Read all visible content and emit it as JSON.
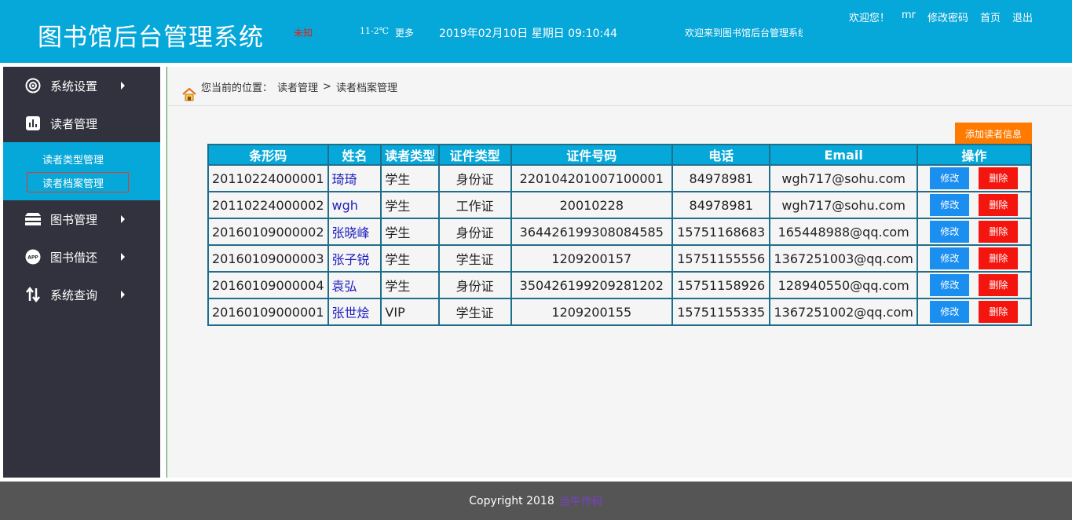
{
  "header": {
    "title": "图书馆后台管理系统",
    "weather_status": "未知",
    "weather_temp": "11-2℃",
    "weather_more": "更多",
    "datetime": "2019年02月10日 星期日 09:10:44",
    "marquee": "欢迎来到图书馆后台管理系统",
    "welcome": "欢迎您！",
    "username": "mr",
    "change_password": "修改密码",
    "home": "首页",
    "logout": "退出"
  },
  "sidebar": {
    "items": [
      {
        "label": "系统设置",
        "icon": "gear-icon"
      },
      {
        "label": "读者管理",
        "icon": "chart-icon"
      },
      {
        "label": "图书管理",
        "icon": "books-icon"
      },
      {
        "label": "图书借还",
        "icon": "app-icon"
      },
      {
        "label": "系统查询",
        "icon": "swap-icon"
      }
    ],
    "sub_items": [
      {
        "label": "读者类型管理"
      },
      {
        "label": "读者档案管理"
      }
    ]
  },
  "breadcrumb": {
    "prefix": "您当前的位置：",
    "level1": "读者管理",
    "separator": ">",
    "level2": "读者档案管理"
  },
  "add_button": "添加读者信息",
  "table": {
    "headers": [
      "条形码",
      "姓名",
      "读者类型",
      "证件类型",
      "证件号码",
      "电话",
      "Email",
      "操作"
    ],
    "edit_label": "修改",
    "delete_label": "删除",
    "rows": [
      {
        "barcode": "20110224000001",
        "name": "琦琦",
        "type": "学生",
        "id_type": "身份证",
        "id_no": "220104201007100001",
        "phone": "84978981",
        "email": "wgh717@sohu.com"
      },
      {
        "barcode": "20110224000002",
        "name": "wgh",
        "type": "学生",
        "id_type": "工作证",
        "id_no": "20010228",
        "phone": "84978981",
        "email": "wgh717@sohu.com"
      },
      {
        "barcode": "20160109000002",
        "name": "张晓峰",
        "type": "学生",
        "id_type": "身份证",
        "id_no": "364426199308084585",
        "phone": "15751168683",
        "email": "165448988@qq.com"
      },
      {
        "barcode": "20160109000003",
        "name": "张子锐",
        "type": "学生",
        "id_type": "学生证",
        "id_no": "1209200157",
        "phone": "15751155556",
        "email": "1367251003@qq.com"
      },
      {
        "barcode": "20160109000004",
        "name": "袁弘",
        "type": "学生",
        "id_type": "身份证",
        "id_no": "350426199209281202",
        "phone": "15751158926",
        "email": "128940550@qq.com"
      },
      {
        "barcode": "20160109000001",
        "name": "张世烩",
        "type": "VIP",
        "id_type": "学生证",
        "id_no": "1209200155",
        "phone": "15751155335",
        "email": "1367251002@qq.com"
      }
    ]
  },
  "footer": {
    "copyright": "Copyright 2018",
    "author": "当牛作码"
  },
  "colors": {
    "header_bg": "#06a7d9",
    "sidebar_bg": "#31323d",
    "add_button": "#ff7a00",
    "edit_button": "#1a8ff0",
    "delete_button": "#f5150f"
  }
}
